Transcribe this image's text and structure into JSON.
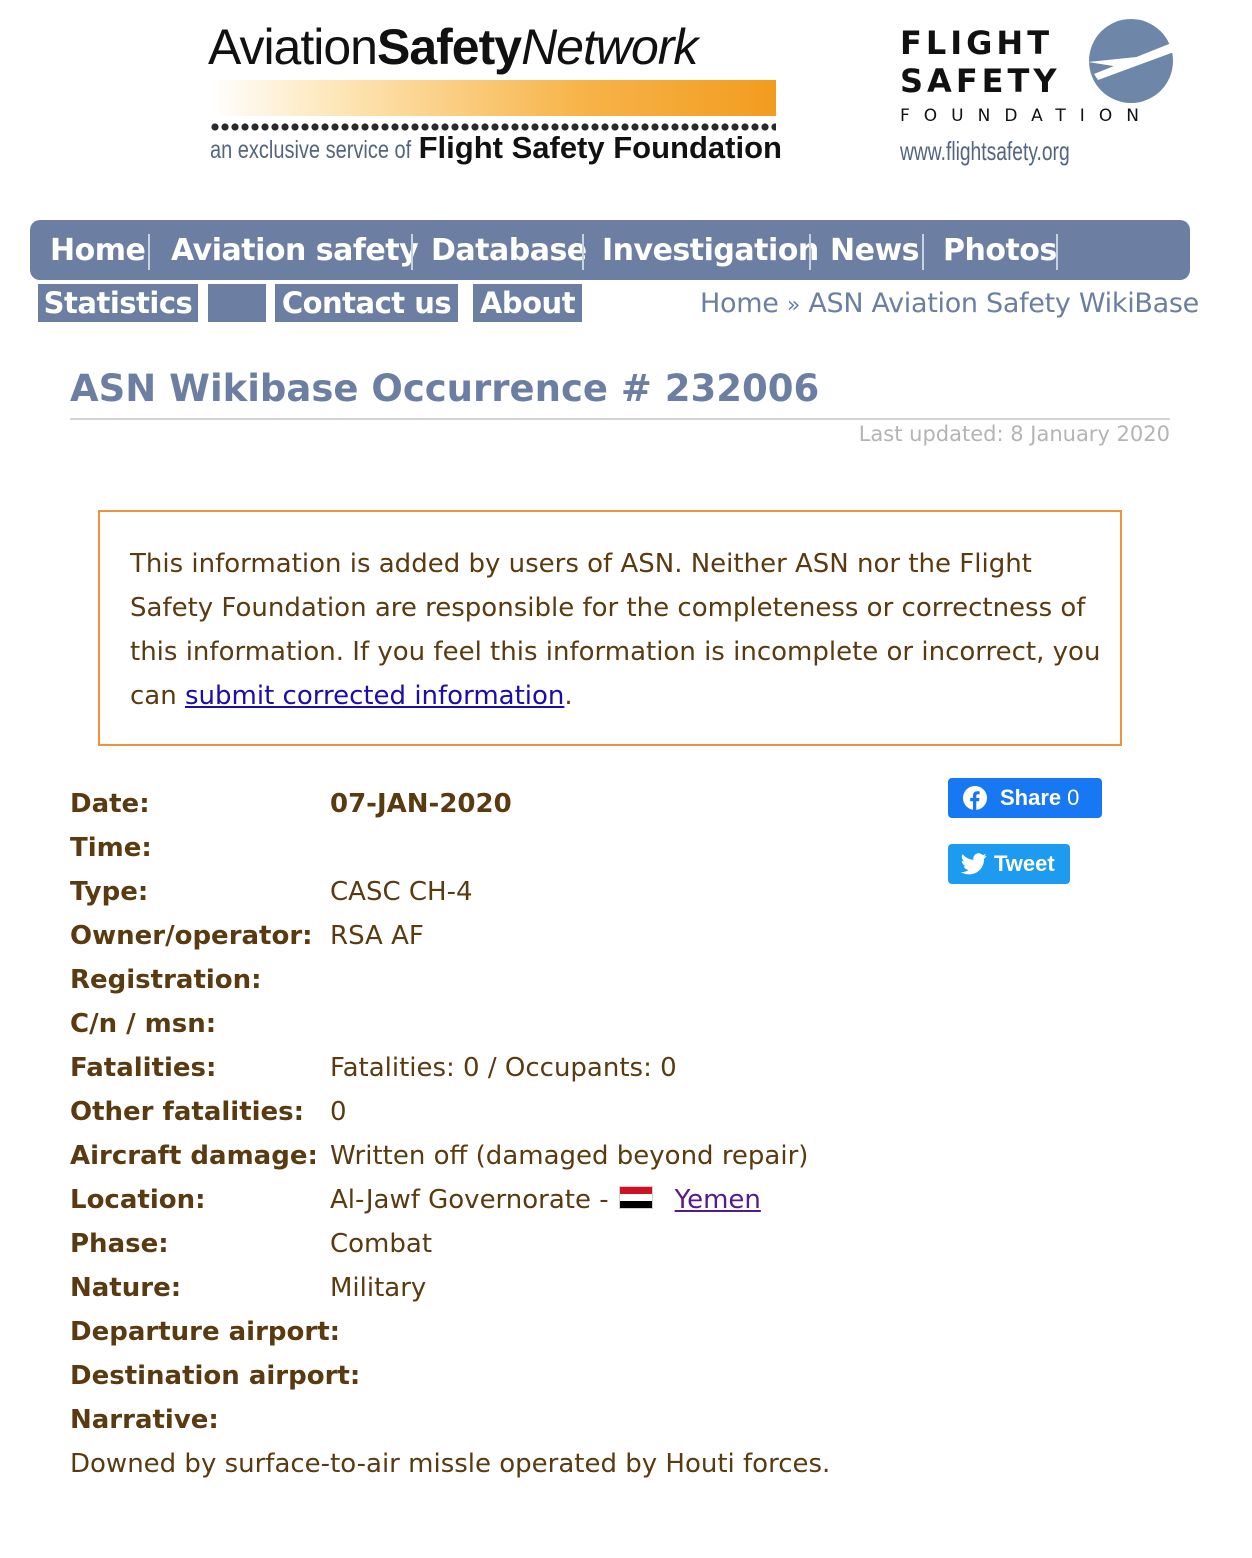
{
  "header": {
    "asn_logo": {
      "part1": "Aviation",
      "part2": "Safety",
      "part3": "Network",
      "tagline_small": "an exclusive service of",
      "tagline_big": "Flight Safety Foundation"
    },
    "fsf_logo": {
      "line1": "FLIGHT",
      "line2": "SAFETY",
      "line3": "FOUNDATION",
      "url": "www.flightsafety.org"
    }
  },
  "nav": {
    "items": [
      "Home",
      "Aviation safety",
      "Database",
      "Investigation",
      "News",
      "Photos"
    ],
    "sub_items": [
      "Statistics",
      "",
      "Contact us",
      "About"
    ]
  },
  "breadcrumb": {
    "home": "Home",
    "separator": "»",
    "current": "ASN Aviation Safety WikiBase"
  },
  "page": {
    "title": "ASN Wikibase Occurrence # 232006",
    "last_updated": "Last updated: 8 January 2020"
  },
  "disclaimer": {
    "text": "This information is added by users of ASN. Neither ASN nor the Flight Safety Foundation are responsible for the completeness or correctness of this information. If you feel this information is incomplete or incorrect, you can ",
    "link": "submit corrected information",
    "end": "."
  },
  "details": {
    "date": {
      "label": "Date:",
      "value": "07-JAN-2020"
    },
    "time": {
      "label": "Time:",
      "value": ""
    },
    "type": {
      "label": "Type:",
      "value": "CASC CH-4"
    },
    "owner": {
      "label": "Owner/operator:",
      "value": "RSA AF"
    },
    "registration": {
      "label": "Registration:",
      "value": ""
    },
    "cn_msn": {
      "label": "C/n / msn:",
      "value": ""
    },
    "fatalities": {
      "label": "Fatalities:",
      "value": "Fatalities: 0 / Occupants: 0"
    },
    "other_fatalities": {
      "label": "Other fatalities:",
      "value": "0"
    },
    "damage": {
      "label": "Aircraft damage:",
      "value": "Written off (damaged beyond repair)"
    },
    "location": {
      "label": "Location:",
      "value": "Al-Jawf Governorate -",
      "country": "Yemen",
      "flag_icon": "yemen-flag-icon"
    },
    "phase": {
      "label": "Phase:",
      "value": "Combat"
    },
    "nature": {
      "label": "Nature:",
      "value": "Military"
    },
    "departure": {
      "label": "Departure airport:",
      "value": ""
    },
    "destination": {
      "label": "Destination airport:",
      "value": ""
    },
    "narrative": {
      "label": "Narrative:",
      "value": "Downed by surface-to-air missle operated by Houti forces."
    }
  },
  "social": {
    "share_label": "Share",
    "share_count": "0",
    "tweet_label": "Tweet",
    "share_icon": "facebook-icon",
    "tweet_icon": "twitter-icon"
  },
  "colors": {
    "nav_bg": "#6c7fa3",
    "title": "#6c7fa3",
    "text": "#5a3a10",
    "disclaimer_border": "#f0923c",
    "link": "#1a0dab",
    "facebook": "#1877f2",
    "twitter": "#1d9bf0"
  }
}
